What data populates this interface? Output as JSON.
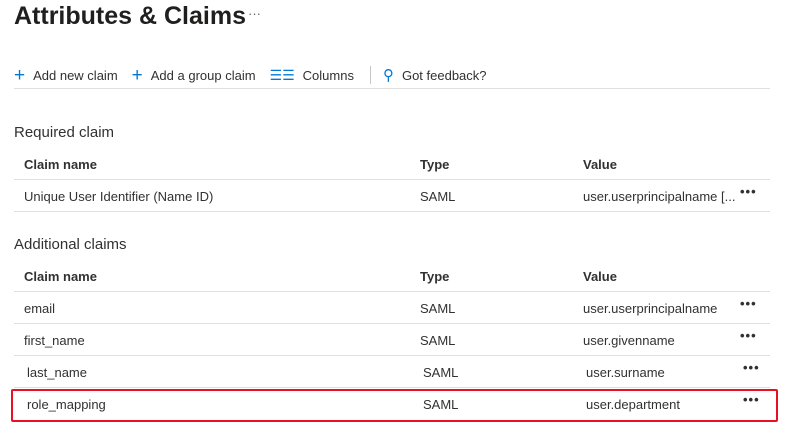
{
  "title": "Attributes & Claims",
  "title_more": "···",
  "toolbar": {
    "add_new_claim": "Add new claim",
    "add_group_claim": "Add a group claim",
    "columns": "Columns",
    "feedback": "Got feedback?"
  },
  "required": {
    "heading": "Required claim",
    "columns": [
      "Claim name",
      "Type",
      "Value"
    ],
    "rows": [
      {
        "name": "Unique User Identifier (Name ID)",
        "type": "SAML",
        "value": "user.userprincipalname [..."
      }
    ]
  },
  "additional": {
    "heading": "Additional claims",
    "columns": [
      "Claim name",
      "Type",
      "Value"
    ],
    "rows": [
      {
        "name": "email",
        "type": "SAML",
        "value": "user.userprincipalname"
      },
      {
        "name": "first_name",
        "type": "SAML",
        "value": "user.givenname"
      },
      {
        "name": "last_name",
        "type": "SAML",
        "value": "user.surname"
      },
      {
        "name": "role_mapping",
        "type": "SAML",
        "value": "user.department"
      }
    ]
  },
  "more": "•••",
  "highlight_color": "#e81123"
}
